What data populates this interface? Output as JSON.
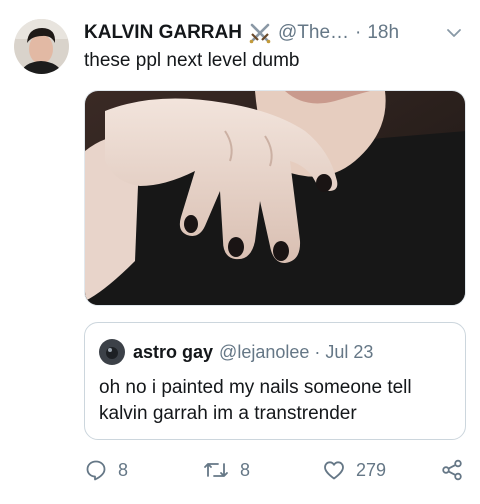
{
  "tweet": {
    "author_name": "KALVIN GARRAH",
    "emoji_icon": "crossed-swords",
    "handle": "@The…",
    "separator": "·",
    "time": "18h",
    "text": "these ppl next level dumb",
    "media_alt": "photo of a hand with black painted nails"
  },
  "quote": {
    "author_name": "astro gay",
    "handle": "@lejanolee",
    "separator": "·",
    "date": "Jul 23",
    "text": "oh no i painted my nails someone tell kalvin garrah im a transtrender"
  },
  "actions": {
    "reply_count": "8",
    "retweet_count": "8",
    "like_count": "279"
  },
  "colors": {
    "text": "#14171a",
    "secondary": "#657786",
    "border": "#ccd6dd"
  }
}
